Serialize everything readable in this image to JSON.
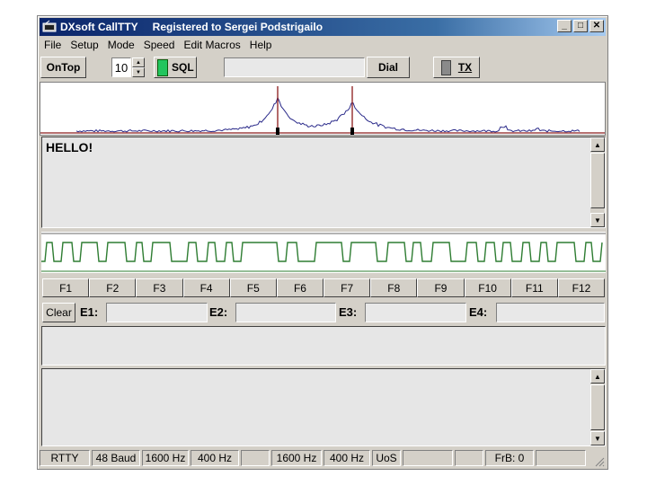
{
  "window": {
    "app_title": "DXsoft CallTTY",
    "registered": "Registered to Sergei Podstrigailo"
  },
  "menu": [
    "File",
    "Setup",
    "Mode",
    "Speed",
    "Edit Macros",
    "Help"
  ],
  "toolbar": {
    "ontop_label": "OnTop",
    "squelch_value": "10",
    "sql_label": "SQL",
    "callsign_value": "",
    "dial_label": "Dial",
    "tx_label": "TX"
  },
  "receive": {
    "text": "HELLO!"
  },
  "function_keys": [
    "F1",
    "F2",
    "F3",
    "F4",
    "F5",
    "F6",
    "F7",
    "F8",
    "F9",
    "F10",
    "F11",
    "F12"
  ],
  "exchange": {
    "clear_label": "Clear",
    "fields": [
      {
        "label": "E1:",
        "value": ""
      },
      {
        "label": "E2:",
        "value": ""
      },
      {
        "label": "E3:",
        "value": ""
      },
      {
        "label": "E4:",
        "value": ""
      }
    ]
  },
  "statusbar": [
    "RTTY",
    "48 Baud",
    "1600 Hz",
    "400 Hz",
    "",
    "1600 Hz",
    "400 Hz",
    "UoS",
    "",
    "",
    "FrB: 0",
    ""
  ],
  "colors": {
    "spectrum_trace": "#2a2a8a",
    "marker": "#8b1a1a",
    "scope_trace": "#2e7d32",
    "sql_led": "#22c55e"
  }
}
